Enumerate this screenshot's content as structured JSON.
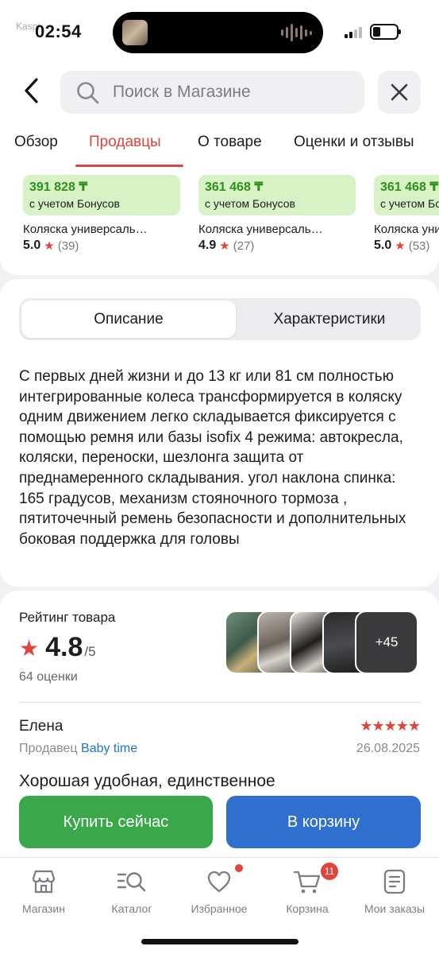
{
  "status": {
    "carrier": "Kaspi",
    "time": "02:54"
  },
  "header": {
    "search_placeholder": "Поиск в Магазине"
  },
  "tabs": [
    {
      "label": "Обзор"
    },
    {
      "label": "Продавцы"
    },
    {
      "label": "О товаре"
    },
    {
      "label": "Оценки и отзывы"
    }
  ],
  "sellers": [
    {
      "price": "391 828 ₸",
      "bonus": "с учетом Бонусов",
      "name": "Коляска универсаль…",
      "rating": "5.0",
      "reviews": "(39)"
    },
    {
      "price": "361 468 ₸",
      "bonus": "с учетом Бонусов",
      "name": "Коляска универсаль…",
      "rating": "4.9",
      "reviews": "(27)"
    },
    {
      "price": "361 468 ₸",
      "bonus": "с учетом Бонусов",
      "name": "Коляска универсаль…",
      "rating": "5.0",
      "reviews": "(53)"
    }
  ],
  "description": {
    "tab_description": "Описание",
    "tab_specs": "Характеристики",
    "text": "С первых дней жизни и до 13 кг или 81 см полностью интегрированные колеса трансформируется в коляску одним движением легко складывается фиксируется с помощью ремня или базы isofix 4 режима: автокресла, коляски, переноски, шезлонга защита от преднамеренного складывания. угол наклона спинка: 165 градусов, механизм стояночного тормоза , пятиточечный ремень безопасности и дополнительных боковая поддержка для головы"
  },
  "rating": {
    "title": "Рейтинг товара",
    "score": "4.8",
    "max": "/5",
    "count": "64 оценки",
    "photos_more": "+45"
  },
  "review": {
    "author": "Елена",
    "stars": 5,
    "seller_label": "Продавец",
    "seller_name": "Baby time",
    "date": "26.08.2025",
    "text": "Хорошая удобная, единственное"
  },
  "actions": {
    "buy_now": "Купить сейчас",
    "add_to_cart": "В корзину"
  },
  "tabbar": [
    {
      "label": "Магазин",
      "icon": "shop-icon"
    },
    {
      "label": "Каталог",
      "icon": "catalog-search-icon"
    },
    {
      "label": "Избранное",
      "icon": "heart-icon"
    },
    {
      "label": "Корзина",
      "icon": "cart-icon",
      "badge": "11"
    },
    {
      "label": "Мои заказы",
      "icon": "orders-icon"
    }
  ],
  "colors": {
    "accent": "#e0443b",
    "green": "#3aa84a",
    "blue": "#2f6fcf",
    "price_bg": "#d7f2c4"
  }
}
